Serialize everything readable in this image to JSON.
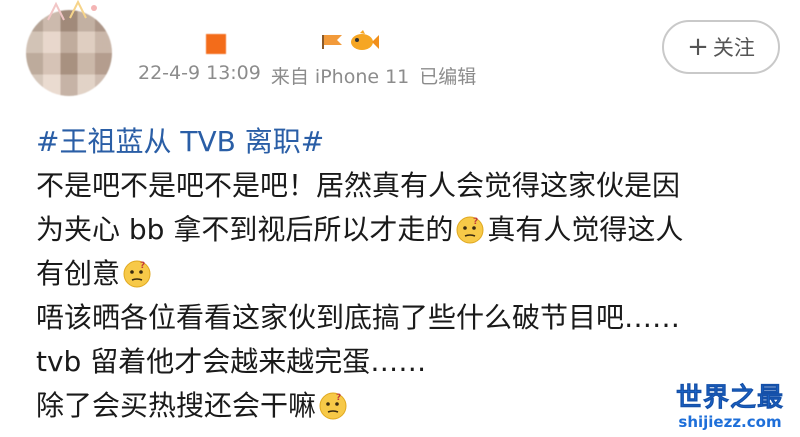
{
  "post": {
    "timestamp": "22-4-9 13:09",
    "source": "来自 iPhone 11",
    "edited": "已编辑",
    "follow_label": "关注",
    "follow_plus": "+"
  },
  "body": {
    "topic": "#王祖蓝从 TVB 离职#",
    "line1": "不是吧不是吧不是吧！居然真有人会觉得这家伙是因",
    "line2_a": "为夹心 bb 拿不到视后所以才走的",
    "line2_b": "真有人觉得这人",
    "line3": "有创意",
    "line4": "唔该晒各位看看这家伙到底搞了些什么破节目吧……",
    "line5": "tvb 留着他才会越来越完蛋……",
    "line6": "除了会买热搜还会干嘛"
  },
  "watermark": {
    "title": "世界之最",
    "domain": "shijiezz.com"
  },
  "colors": {
    "topic": "#2a5ea6",
    "text": "#1a1a1a",
    "meta": "#8c8c8c",
    "watermark": "#1e6fd9"
  },
  "icons": {
    "emoji": "thinking-face-icon",
    "badge1": "flag-badge-icon",
    "badge2": "fish-badge-icon"
  }
}
